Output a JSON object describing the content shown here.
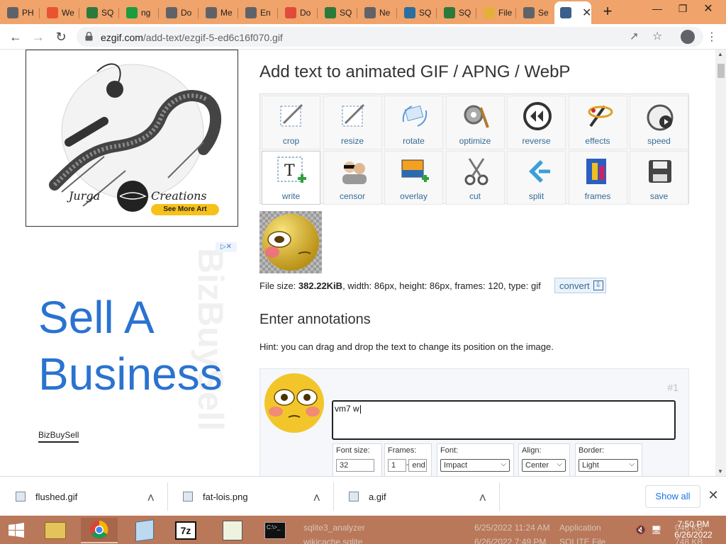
{
  "browser": {
    "tabs": [
      {
        "label": "PH",
        "color": "#5f6368",
        "icon": "globe-icon"
      },
      {
        "label": "We",
        "color": "#e8542f",
        "icon": "app-icon"
      },
      {
        "label": "SQ",
        "color": "#2b7a3b",
        "icon": "sqlite-icon"
      },
      {
        "label": "ng",
        "color": "#1a9c3f",
        "icon": "n-icon"
      },
      {
        "label": "Do",
        "color": "#5f6368",
        "icon": "download-icon"
      },
      {
        "label": "Me",
        "color": "#5f6368",
        "icon": "globe-icon"
      },
      {
        "label": "En",
        "color": "#5f6368",
        "icon": "globe-icon"
      },
      {
        "label": "Do",
        "color": "#e24a3a",
        "icon": "doc-icon"
      },
      {
        "label": "SQ",
        "color": "#2b7a3b",
        "icon": "sqlite-icon"
      },
      {
        "label": "Ne",
        "color": "#5f6368",
        "icon": "globe-icon"
      },
      {
        "label": "SQ",
        "color": "#2b6ea0",
        "icon": "diamond-icon"
      },
      {
        "label": "SQ",
        "color": "#2b7a3b",
        "icon": "sqlite-icon"
      },
      {
        "label": "File",
        "color": "#e3b13a",
        "icon": "folder-icon"
      },
      {
        "label": "Se",
        "color": "#5f6368",
        "icon": "gear-icon"
      }
    ],
    "active_tab_icon": "ezgif-icon",
    "url_domain": "ezgif.com",
    "url_path": "/add-text/ezgif-5-ed6c16f070.gif"
  },
  "ads": {
    "top_brand_left": "Jurga",
    "top_brand_right": "Creations",
    "top_cta": "See More Art",
    "sell_line1": "Sell A",
    "sell_line2": "Business",
    "sell_brand": "BizBuySell",
    "watermark": "BizBuySell"
  },
  "page": {
    "title": "Add text to animated GIF / APNG / WebP",
    "tools": [
      {
        "label": "crop",
        "icon": "crop-icon"
      },
      {
        "label": "resize",
        "icon": "resize-icon"
      },
      {
        "label": "rotate",
        "icon": "rotate-icon"
      },
      {
        "label": "optimize",
        "icon": "optimize-icon"
      },
      {
        "label": "reverse",
        "icon": "reverse-icon"
      },
      {
        "label": "effects",
        "icon": "effects-icon"
      },
      {
        "label": "speed",
        "icon": "speed-icon"
      },
      {
        "label": "write",
        "icon": "write-icon"
      },
      {
        "label": "censor",
        "icon": "censor-icon"
      },
      {
        "label": "overlay",
        "icon": "overlay-icon"
      },
      {
        "label": "cut",
        "icon": "scissors-icon"
      },
      {
        "label": "split",
        "icon": "split-icon"
      },
      {
        "label": "frames",
        "icon": "frames-icon"
      },
      {
        "label": "save",
        "icon": "floppy-icon"
      }
    ],
    "fileinfo_prefix": "File size: ",
    "file_size": "382.22KiB",
    "fileinfo_rest": ", width: 86px, height: 86px, frames: 120, type: gif",
    "convert_label": "convert",
    "annotations_title": "Enter annotations",
    "hint": "Hint: you can drag and drop the text to change its position on the image.",
    "annotation": {
      "number": "#1",
      "text": "vm7 w",
      "font_size_label": "Font size:",
      "font_size": "32",
      "frames_label": "Frames:",
      "frame_from": "1",
      "frame_to": "end",
      "font_label": "Font:",
      "font_value": "Impact",
      "align_label": "Align:",
      "align_value": "Center",
      "border_label": "Border:",
      "border_value": "Light"
    }
  },
  "downloads": {
    "items": [
      "flushed.gif",
      "fat-lois.png",
      "a.gif"
    ],
    "show_all": "Show all"
  },
  "taskbar": {
    "behind_rows": [
      {
        "name": "sqlite3_analyzer",
        "date": "6/25/2022 11:24 AM",
        "type": "Application",
        "size": "046 KB"
      },
      {
        "name": "wikicache.sqlite",
        "date": "6/26/2022 7:49 PM",
        "type": "SQLITE File",
        "size": "748 KB"
      }
    ],
    "time": "7:50 PM",
    "date": "6/26/2022"
  }
}
